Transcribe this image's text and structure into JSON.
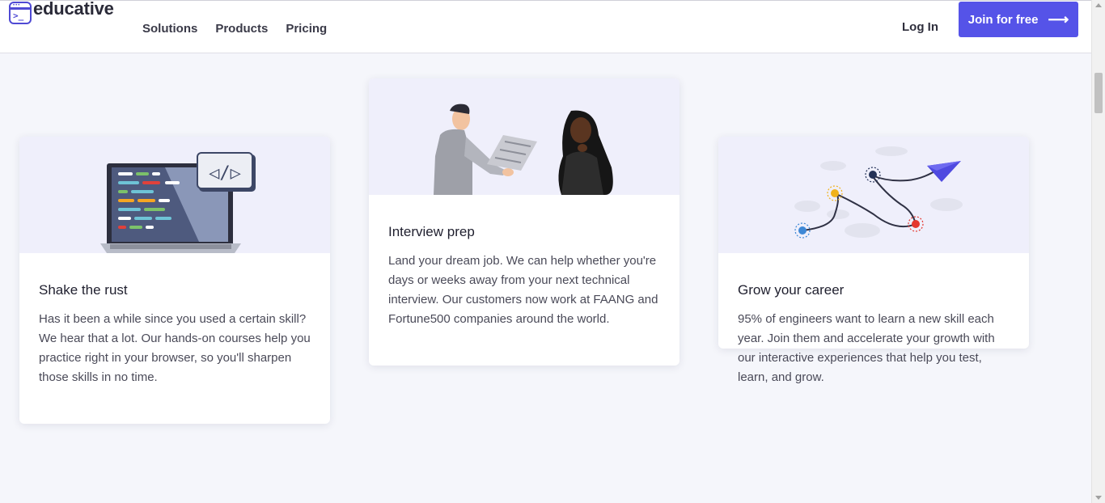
{
  "brand": {
    "name": "educative",
    "accent": "#5553e8"
  },
  "nav": {
    "items": [
      {
        "label": "Solutions"
      },
      {
        "label": "Products"
      },
      {
        "label": "Pricing"
      }
    ],
    "login_label": "Log In",
    "join_label": "Join for free",
    "join_icon": "arrow-right-icon"
  },
  "cards": [
    {
      "title": "Shake the rust",
      "description": "Has it been a while since you used a certain skill? We hear that a lot. Our hands-on courses help you practice right in your browser, so you'll sharpen those skills in no time.",
      "illustration": "laptop-code-illustration"
    },
    {
      "title": "Interview prep",
      "description": "Land your dream job. We can help whether you're days or weeks away from your next technical interview. Our customers now work at FAANG and Fortune500 companies around the world.",
      "illustration": "interview-people-illustration"
    },
    {
      "title": "Grow your career",
      "description": "95% of engineers want to learn a new skill each year. Join them and accelerate your growth with our interactive experiences that help you test, learn, and grow.",
      "illustration": "career-path-illustration"
    }
  ]
}
